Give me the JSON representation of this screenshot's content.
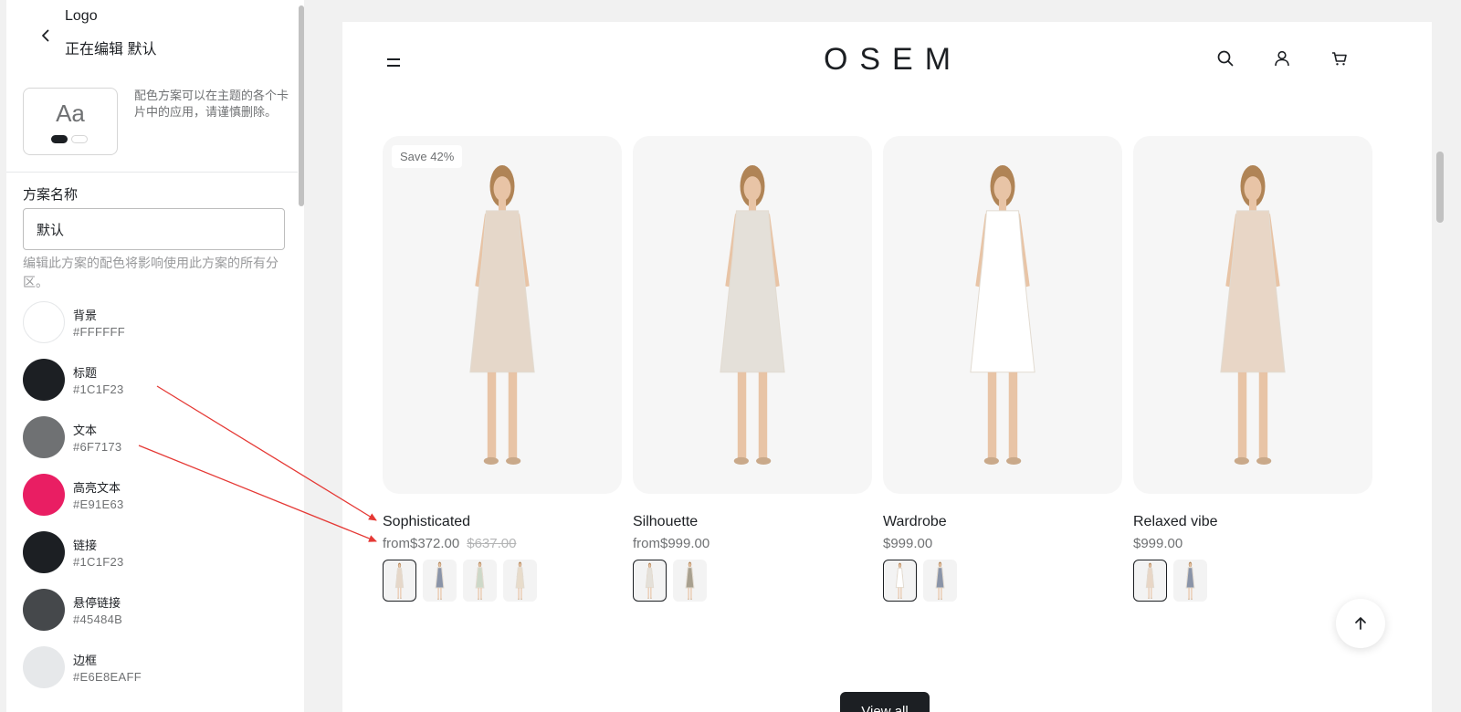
{
  "editor": {
    "logo_label": "Logo",
    "title": "正在编辑 默认",
    "preview": {
      "sample_text": "Aa"
    },
    "scheme_note": "配色方案可以在主题的各个卡片中的应用，请谨慎删除。",
    "scheme_name_label": "方案名称",
    "scheme_name_value": "默认",
    "scheme_help": "编辑此方案的配色将影响使用此方案的所有分区。",
    "swatches": [
      {
        "name": "背景",
        "hex": "#FFFFFF",
        "color": "#FFFFFF"
      },
      {
        "name": "标题",
        "hex": "#1C1F23",
        "color": "#1C1F23"
      },
      {
        "name": "文本",
        "hex": "#6F7173",
        "color": "#6F7173"
      },
      {
        "name": "高亮文本",
        "hex": "#E91E63",
        "color": "#E91E63"
      },
      {
        "name": "链接",
        "hex": "#1C1F23",
        "color": "#1C1F23"
      },
      {
        "name": "悬停链接",
        "hex": "#45484B",
        "color": "#45484B"
      },
      {
        "name": "边框",
        "hex": "#E6E8EAFF",
        "color": "#E6E8EA"
      }
    ]
  },
  "store": {
    "brand": "OSEM",
    "icons": [
      "menu-icon",
      "search-icon",
      "user-icon",
      "cart-icon"
    ],
    "products": [
      {
        "title": "Sophisticated",
        "price": "from$372.00",
        "compare_price": "$637.00",
        "badge": "Save 42%",
        "dress_color": "#e5d7c9",
        "thumbs": [
          "#e5d7c9",
          "#8a94a8",
          "#cdd8c8",
          "#e8dccb"
        ]
      },
      {
        "title": "Silhouette",
        "price": "from$999.00",
        "compare_price": "",
        "badge": "",
        "dress_color": "#e4e0d9",
        "thumbs": [
          "#e4e0d9",
          "#a8a08f"
        ]
      },
      {
        "title": "Wardrobe",
        "price": "$999.00",
        "compare_price": "",
        "badge": "",
        "dress_color": "#ffffff",
        "thumbs": [
          "#ffffff",
          "#8a94a8"
        ]
      },
      {
        "title": "Relaxed vibe",
        "price": "$999.00",
        "compare_price": "",
        "badge": "",
        "dress_color": "#e8d6c6",
        "thumbs": [
          "#e8d6c6",
          "#8a94a8"
        ]
      }
    ],
    "view_all_label": "View all",
    "back_to_top_icon": "arrow-up-icon"
  },
  "colors": {
    "accent": "#1C1F23",
    "annotation_arrow": "#E53935"
  }
}
